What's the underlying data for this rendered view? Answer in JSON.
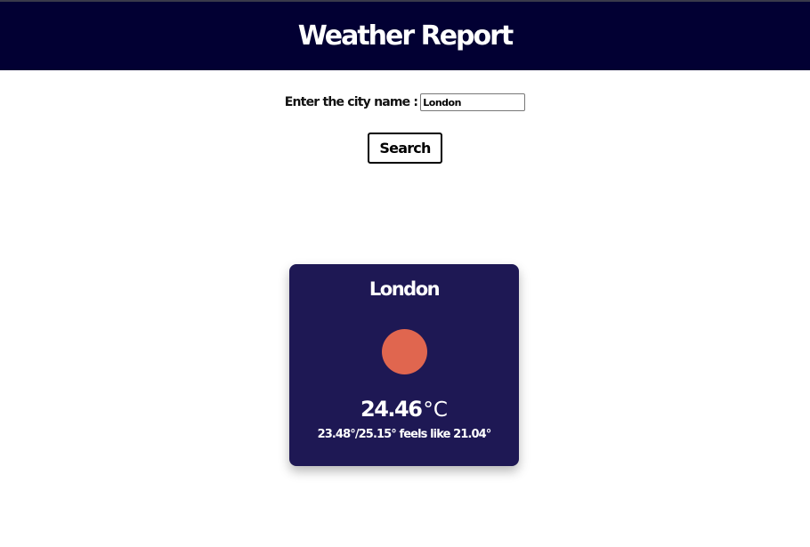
{
  "header": {
    "title": "Weather Report"
  },
  "search": {
    "label": "Enter the city name :",
    "value": "London",
    "button_label": "Search"
  },
  "card": {
    "city": "London",
    "icon": "sun-icon",
    "temperature": "24.46",
    "unit": "°C",
    "detail": "23.48°/25.15° feels like 21.04°"
  },
  "colors": {
    "header_bg": "#020033",
    "card_bg": "#1e1854",
    "icon_color": "#e0664f"
  }
}
